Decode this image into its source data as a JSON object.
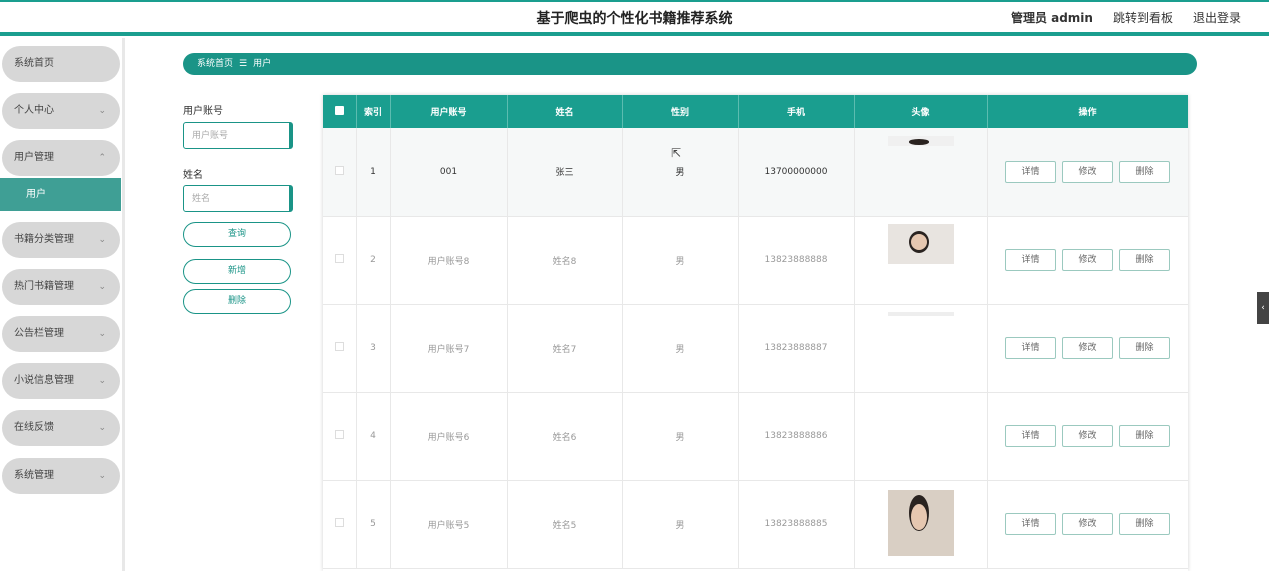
{
  "header": {
    "title": "基于爬虫的个性化书籍推荐系统",
    "admin": "管理员 admin",
    "dashboard_link": "跳转到看板",
    "logout_link": "退出登录"
  },
  "sidebar": {
    "items": [
      {
        "label": "系统首页"
      },
      {
        "label": "个人中心"
      },
      {
        "label": "用户管理"
      },
      {
        "label": "书籍分类管理"
      },
      {
        "label": "热门书籍管理"
      },
      {
        "label": "公告栏管理"
      },
      {
        "label": "小说信息管理"
      },
      {
        "label": "在线反馈"
      },
      {
        "label": "系统管理"
      }
    ],
    "sub_item": "用户"
  },
  "breadcrumb": {
    "home": "系统首页",
    "sep": "☰",
    "current": "用户"
  },
  "search": {
    "account_label": "用户账号",
    "account_placeholder": "用户账号",
    "name_label": "姓名",
    "name_placeholder": "姓名",
    "query_button": "查询",
    "add_button": "新增",
    "delete_button": "删除"
  },
  "table": {
    "headers": [
      "索引",
      "用户账号",
      "姓名",
      "性别",
      "手机",
      "头像",
      "操作"
    ],
    "rows": [
      {
        "index": "1",
        "account": "001",
        "name": "张三",
        "gender": "男",
        "phone": "13700000000"
      },
      {
        "index": "2",
        "account": "用户账号8",
        "name": "姓名8",
        "gender": "男",
        "phone": "13823888888"
      },
      {
        "index": "3",
        "account": "用户账号7",
        "name": "姓名7",
        "gender": "男",
        "phone": "13823888887"
      },
      {
        "index": "4",
        "account": "用户账号6",
        "name": "姓名6",
        "gender": "男",
        "phone": "13823888886"
      },
      {
        "index": "5",
        "account": "用户账号5",
        "name": "姓名5",
        "gender": "男",
        "phone": "13823888885"
      }
    ],
    "actions": {
      "detail": "详情",
      "edit": "修改",
      "delete": "删除"
    }
  },
  "colors": {
    "accent": "#1a9e8f"
  }
}
